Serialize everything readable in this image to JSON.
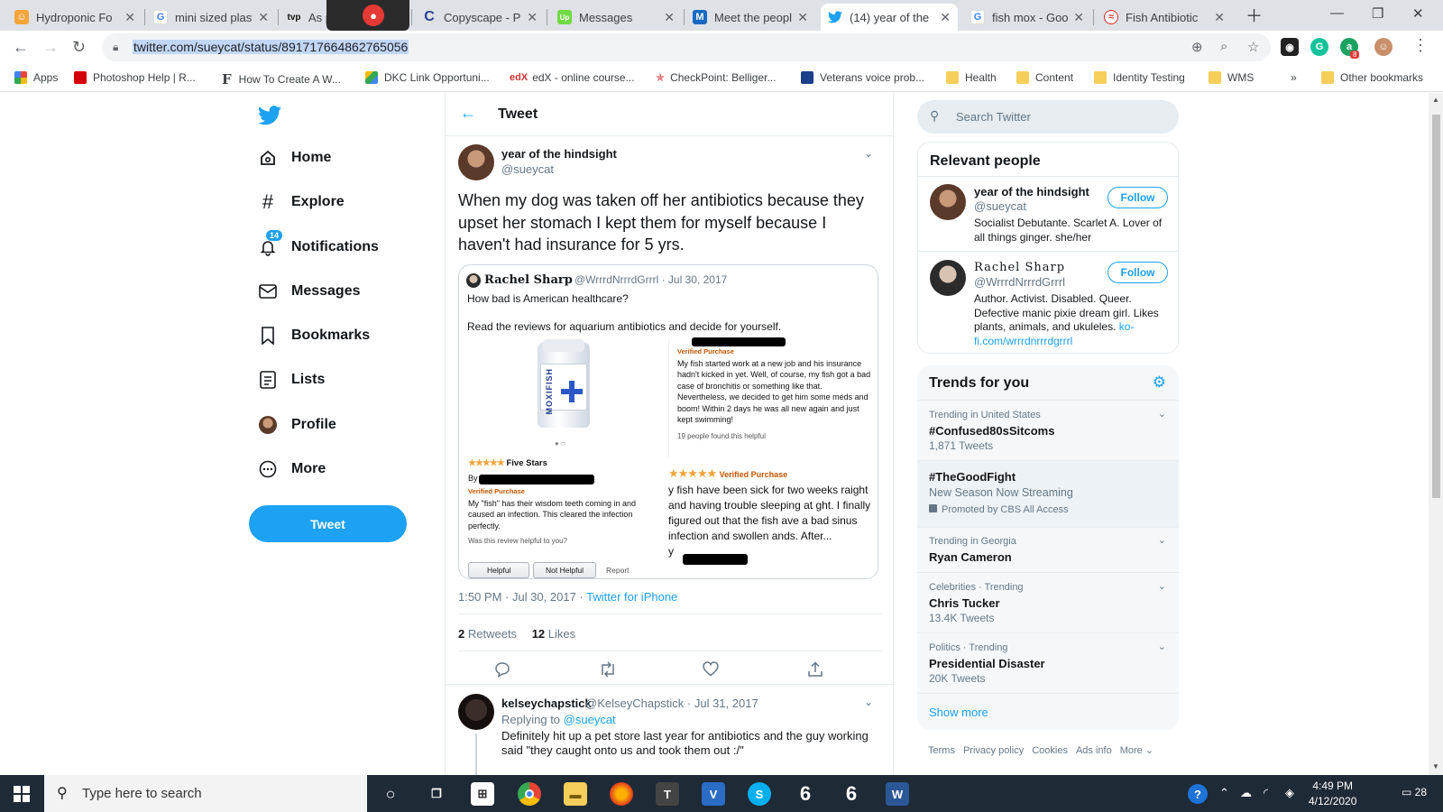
{
  "browser": {
    "tabs": [
      {
        "title": "Hydroponic Fo",
        "fav_color": "#f4a53a",
        "fav_glyph": "☺"
      },
      {
        "title": "mini sized plast",
        "fav_color": "#4285f4",
        "fav_glyph": "G"
      },
      {
        "title": "As p",
        "fav_color": "#111111",
        "fav_glyph": "tvp"
      },
      {
        "title": "Copyscape - Pr",
        "fav_color": "#2c3e91",
        "fav_glyph": "C"
      },
      {
        "title": "Messages",
        "fav_color": "#6fda44",
        "fav_glyph": "Up"
      },
      {
        "title": "Meet the peopl",
        "fav_color": "#1769c4",
        "fav_glyph": "M"
      },
      {
        "title": "(14) year of the",
        "fav_color": "#1da1f2",
        "fav_glyph": "t"
      },
      {
        "title": "fish mox - Goo",
        "fav_color": "#4285f4",
        "fav_glyph": "G"
      },
      {
        "title": "Fish Antibiotic",
        "fav_color": "#d93025",
        "fav_glyph": "≈"
      }
    ],
    "url": "twitter.com/sueycat/status/891717664862765056",
    "extension_badge": "8",
    "bookmarks": [
      "Apps",
      "Photoshop Help | R...",
      "How To Create A W...",
      "DKC Link Opportuni...",
      "edX - online course...",
      "CheckPoint: Belliger...",
      "Veterans voice prob...",
      "Health",
      "Content",
      "Identity Testing",
      "WMS",
      "»",
      "Other bookmarks"
    ]
  },
  "nav": {
    "items": [
      "Home",
      "Explore",
      "Notifications",
      "Messages",
      "Bookmarks",
      "Lists",
      "Profile",
      "More"
    ],
    "notifications_badge": "14",
    "tweet_button": "Tweet"
  },
  "header": {
    "title": "Tweet"
  },
  "tweet": {
    "name": "year of the hindsight",
    "handle": "@sueycat",
    "text": "When my dog was taken off her antibiotics because they upset her stomach I kept them for myself because I haven't had insurance for 5 yrs.",
    "quote": {
      "name": "Rachel Sharp",
      "meta": "@WrrrdNrrrdGrrrl · Jul 30, 2017",
      "line1": "How bad is American healthcare?",
      "line2": "Read the reviews for aquarium antibiotics and decide for yourself.",
      "image": {
        "bottle_brand": "MOXIFISH",
        "review_top_label": "Verified Purchase",
        "review_top_text": "My fish started work at a new job and his insurance hadn't kicked in yet. Well, of course, my fish got a bad case of bronchitis or something like that. Nevertheless, we decided to get him some meds and boom! Within 2 days he was all new again and just kept swimming!",
        "review_top_helpful": "19 people found this helpful",
        "five_stars_title": "Five Stars",
        "review_left_by": "By",
        "review_left_label": "Verified Purchase",
        "review_left_text": "My \"fish\" has their wisdom teeth coming in and caused an infection. This cleared the infection perfectly.",
        "review_left_question": "Was this review helpful to you?",
        "btn_helpful": "Helpful",
        "btn_not_helpful": "Not Helpful",
        "btn_report": "Report",
        "review_right_label": "Verified Purchase",
        "review_right_text": "y fish have been sick for two weeks raight and having trouble sleeping at ght. I finally figured out that the fish ave a bad sinus infection and swollen ands. After...",
        "review_right_by": "y"
      }
    },
    "time": "1:50 PM · Jul 30, 2017 · ",
    "source": "Twitter for iPhone",
    "retweets": "2",
    "retweets_label": "Retweets",
    "likes": "12",
    "likes_label": "Likes"
  },
  "reply": {
    "name": "kelseychapstick",
    "meta": "@KelseyChapstick · Jul 31, 2017",
    "replying_to_label": "Replying to ",
    "replying_to": "@sueycat",
    "text": "Definitely hit up a pet store last year for antibiotics and the guy working said \"they caught onto us and took them out :/\""
  },
  "sidebar": {
    "search_placeholder": "Search Twitter",
    "relevant_title": "Relevant people",
    "people": [
      {
        "name": "year of the hindsight",
        "handle": "@sueycat",
        "bio": "Socialist Debutante. Scarlet A. Lover of all things ginger. she/her",
        "link": "",
        "follow": "Follow"
      },
      {
        "name": "Rachel Sharp",
        "handle": "@WrrrdNrrrdGrrrl",
        "bio": "Author. Activist. Disabled. Queer. Defective manic pixie dream girl. Likes plants, animals, and ukuleles. ",
        "link": "ko-fi.com/wrrrdnrrrdgrrrl",
        "follow": "Follow"
      }
    ],
    "trends_title": "Trends for you",
    "trends": [
      {
        "meta": "Trending in United States",
        "name": "#Confused80sSitcoms",
        "sub": "1,871 Tweets"
      },
      {
        "meta": "",
        "name": "#TheGoodFight",
        "sub": "New Season Now Streaming",
        "promo": "Promoted by CBS All Access"
      },
      {
        "meta": "Trending in Georgia",
        "name": "Ryan Cameron",
        "sub": ""
      },
      {
        "meta": "Celebrities · Trending",
        "name": "Chris Tucker",
        "sub": "13.4K Tweets"
      },
      {
        "meta": "Politics · Trending",
        "name": "Presidential Disaster",
        "sub": "20K Tweets"
      }
    ],
    "show_more": "Show more",
    "footer": [
      "Terms",
      "Privacy policy",
      "Cookies",
      "Ads info",
      "More ⌄"
    ]
  },
  "taskbar": {
    "search_text": "Type here to search",
    "time": "4:49 PM",
    "date": "4/12/2020",
    "notification_count": "28"
  }
}
